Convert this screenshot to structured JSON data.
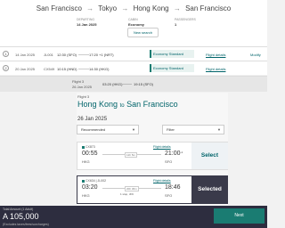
{
  "route": {
    "from": "San Francisco",
    "via": "Tokyo",
    "to": "Hong Kong",
    "back": "San Francisco"
  },
  "meta": {
    "departing_label": "DEPARTING",
    "departing": "14 Jan 2025",
    "cabin_label": "CABIN",
    "cabin": "Economy",
    "passengers_label": "PASSENGERS",
    "passengers": "1"
  },
  "new_search_label": "New search",
  "flights": [
    {
      "num": "1",
      "date": "14 Jan 2025",
      "flight_no": "JL001",
      "dep": "12:30 (SFO)",
      "arr": "17:20 +1 (NRT)",
      "cabin": "Economy Standard",
      "details": "Flight details",
      "modify": "Modify"
    },
    {
      "num": "2",
      "date": "20 Jan 2025",
      "flight_no": "CX549",
      "dep": "10:15 (HND)",
      "arr": "14:30 (HKG)",
      "cabin": "Economy Standard",
      "details": "Flight details"
    }
  ],
  "flight3": {
    "label": "Flight 3",
    "date": "26 Jan 2025",
    "dep": "03:20 (HKG)",
    "arr": "19:15 (SFO)"
  },
  "panel": {
    "flight_label": "Flight 3",
    "from": "Hong Kong",
    "to_word": "to",
    "to": "San Francisco",
    "date": "26 Jan 2025",
    "sort": "Recommended",
    "filter": "Filter"
  },
  "options": [
    {
      "airline": "CX873",
      "details": "Flight details",
      "dep_time": "00:55",
      "arr_time": "21:00",
      "arr_sup": "-1",
      "dep_code": "HKG",
      "arr_code": "SFO",
      "duration": "12h 5m",
      "stop": "",
      "button": "Select"
    },
    {
      "airline": "CX634 | JL002",
      "details": "Flight details",
      "dep_time": "03:20",
      "arr_time": "18:46",
      "arr_sup": "",
      "dep_code": "HKG",
      "arr_code": "SFO",
      "duration": "20h 36m",
      "stop": "1 stop, JFK",
      "button": "Selected"
    }
  ],
  "bottom": {
    "total_label": "Total Amount (1 Adult)",
    "amount": "A 105,000",
    "note": "(Excludes taxes/fees/surcharges)",
    "next": "Next"
  },
  "colors": {
    "accent": "#00646a",
    "dark": "#2d2d3f",
    "teal_button": "#1a7c72"
  }
}
